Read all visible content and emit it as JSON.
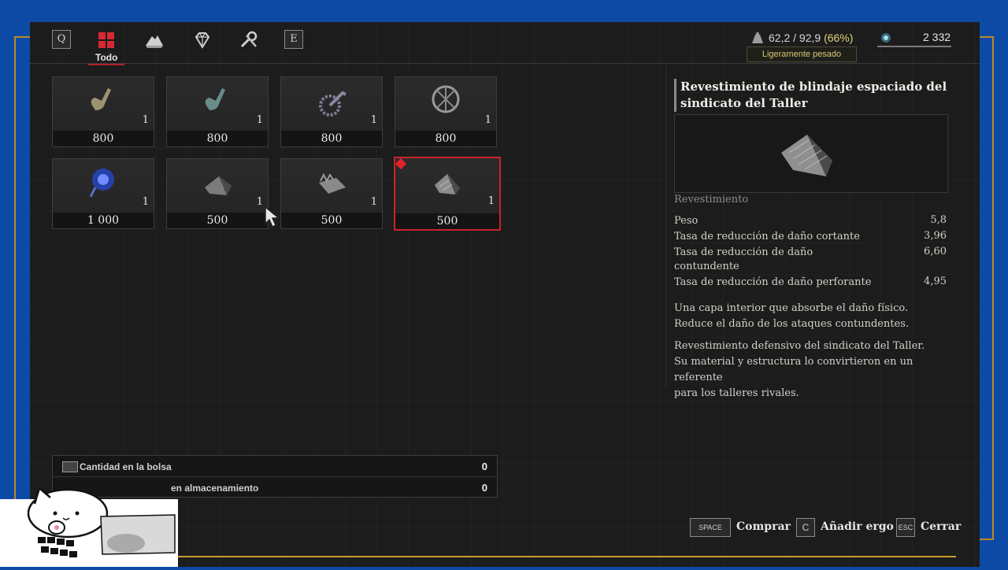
{
  "nav": {
    "left_key": "Q",
    "right_key": "E",
    "active_tab_label": "Todo",
    "tabs": [
      "all-icon",
      "mound-icon",
      "gem-icon",
      "tools-icon"
    ]
  },
  "header": {
    "weight": "62,2 / 92,9",
    "weight_pct": "(66%)",
    "weight_status": "Ligeramente pesado",
    "ergo": "2 332"
  },
  "items": [
    {
      "qty": "1",
      "price": "800",
      "icon": "crank-icon"
    },
    {
      "qty": "1",
      "price": "800",
      "icon": "crank-teal-icon"
    },
    {
      "qty": "1",
      "price": "800",
      "icon": "gear-crank-icon"
    },
    {
      "qty": "1",
      "price": "800",
      "icon": "wheel-icon"
    },
    {
      "qty": "1",
      "price": "1 000",
      "icon": "blue-orb-icon"
    },
    {
      "qty": "1",
      "price": "500",
      "icon": "plate-icon"
    },
    {
      "qty": "1",
      "price": "500",
      "icon": "plate-spiked-icon"
    },
    {
      "qty": "1",
      "price": "500",
      "icon": "plate-spaced-icon"
    }
  ],
  "quantity": {
    "bag_label": "Cantidad en la bolsa",
    "bag_value": "0",
    "storage_label": "en almacenamiento",
    "storage_value": "0"
  },
  "detail": {
    "title": "Revestimiento de blindaje espaciado del sindicato del Taller",
    "category": "Revestimiento",
    "stats": [
      {
        "name": "Peso",
        "value": "5,8"
      },
      {
        "name": "Tasa de reducción de daño cortante",
        "value": "3,96"
      },
      {
        "name": "Tasa de reducción de daño contundente",
        "value": "6,60"
      },
      {
        "name": "Tasa de reducción de daño perforante",
        "value": "4,95"
      }
    ],
    "desc1_line1": "Una capa interior que absorbe el daño físico.",
    "desc1_line2": "Reduce el daño de los ataques contundentes.",
    "desc2_line1": "Revestimiento defensivo del sindicato del Taller.",
    "desc2_line2": "Su material y estructura lo convirtieron en un referente",
    "desc2_line3": "para los talleres rivales."
  },
  "footer": {
    "buy_key": "SPACE",
    "buy_label": "Comprar",
    "ergo_key": "C",
    "ergo_label": "Añadir ergo",
    "close_key": "ESC",
    "close_label": "Cerrar"
  },
  "colors": {
    "accent": "#c9242b",
    "frame": "#0d4aa6",
    "gold": "#c99a2e",
    "status": "#d9c874"
  }
}
